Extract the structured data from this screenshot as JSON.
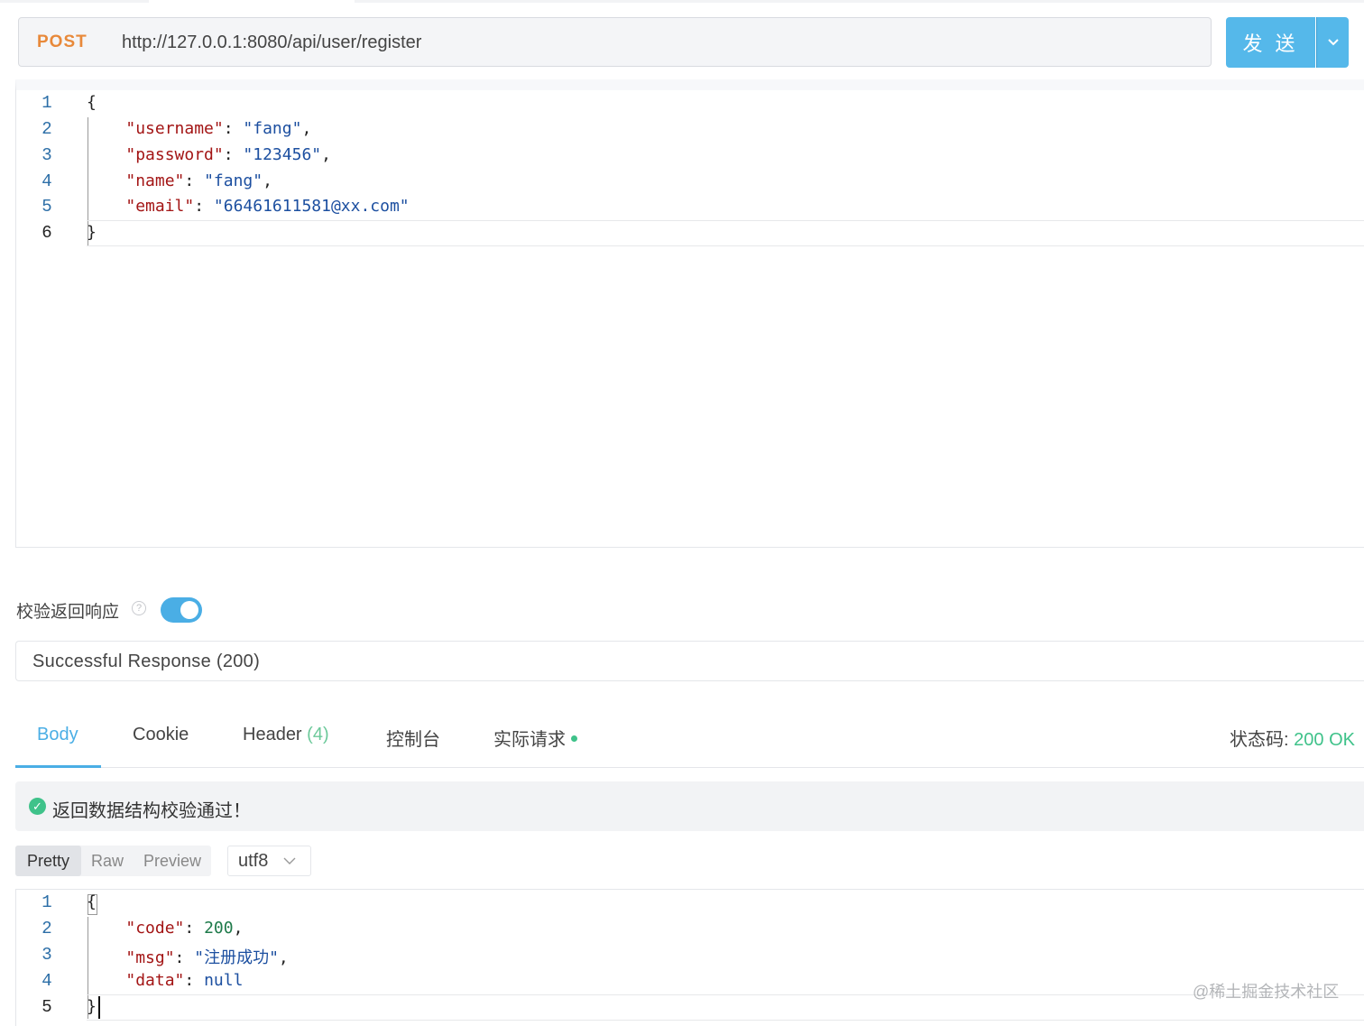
{
  "request": {
    "method": "POST",
    "url": "http://127.0.0.1:8080/api/user/register",
    "send_label": "发 送"
  },
  "request_body": {
    "line_numbers": [
      "1",
      "2",
      "3",
      "4",
      "5",
      "6"
    ],
    "lines": {
      "open": "{",
      "username_key": "\"username\"",
      "username_val": "\"fang\"",
      "password_key": "\"password\"",
      "password_val": "\"123456\"",
      "name_key": "\"name\"",
      "name_val": "\"fang\"",
      "email_key": "\"email\"",
      "email_val": "\"66461611581@xx.com\"",
      "close": "}"
    }
  },
  "validation": {
    "label": "校验返回响应",
    "help": "?",
    "enabled": true,
    "selected_response": "Successful Response (200)"
  },
  "tabs": {
    "body": "Body",
    "cookie": "Cookie",
    "header": "Header",
    "header_count": "(4)",
    "console": "控制台",
    "actual_request": "实际请求",
    "status_label": "状态码: ",
    "status_value": "200 OK"
  },
  "result": {
    "message": "返回数据结构校验通过！",
    "icon": "check-circle-icon"
  },
  "view": {
    "pretty": "Pretty",
    "raw": "Raw",
    "preview": "Preview",
    "encoding": "utf8"
  },
  "response_body": {
    "line_numbers": [
      "1",
      "2",
      "3",
      "4",
      "5"
    ],
    "lines": {
      "open": "{",
      "code_key": "\"code\"",
      "code_val": "200",
      "msg_key": "\"msg\"",
      "msg_val": "\"注册成功\"",
      "data_key": "\"data\"",
      "data_val": "null",
      "close": "}"
    }
  },
  "watermark": "@稀土掘金技术社区",
  "colors": {
    "method": "#e8893a",
    "accent": "#55b8ea",
    "success": "#3fc28a",
    "json_key": "#a31515",
    "json_string": "#1c4fa0",
    "json_number": "#1e7a4a"
  }
}
